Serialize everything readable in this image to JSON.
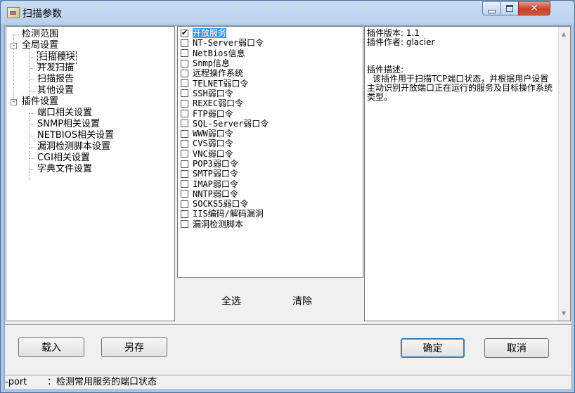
{
  "window": {
    "title": "扫描参数"
  },
  "tree": {
    "items": [
      {
        "label": "检测范围",
        "level": 0,
        "expander": ""
      },
      {
        "label": "全局设置",
        "level": 0,
        "expander": "-"
      },
      {
        "label": "扫描模块",
        "level": 1,
        "expander": ""
      },
      {
        "label": "并发扫描",
        "level": 1,
        "expander": ""
      },
      {
        "label": "扫描报告",
        "level": 1,
        "expander": ""
      },
      {
        "label": "其他设置",
        "level": 1,
        "expander": ""
      },
      {
        "label": "插件设置",
        "level": 0,
        "expander": "-"
      },
      {
        "label": "端口相关设置",
        "level": 1,
        "expander": ""
      },
      {
        "label": "SNMP相关设置",
        "level": 1,
        "expander": ""
      },
      {
        "label": "NETBIOS相关设置",
        "level": 1,
        "expander": ""
      },
      {
        "label": "漏洞检测脚本设置",
        "level": 1,
        "expander": ""
      },
      {
        "label": "CGI相关设置",
        "level": 1,
        "expander": ""
      },
      {
        "label": "字典文件设置",
        "level": 1,
        "expander": ""
      }
    ]
  },
  "modules": {
    "items": [
      {
        "label": "开放服务",
        "checked": true
      },
      {
        "label": "NT-Server弱口令",
        "checked": false
      },
      {
        "label": "NetBios信息",
        "checked": false
      },
      {
        "label": "Snmp信息",
        "checked": false
      },
      {
        "label": "远程操作系统",
        "checked": false
      },
      {
        "label": "TELNET弱口令",
        "checked": false
      },
      {
        "label": "SSH弱口令",
        "checked": false
      },
      {
        "label": "REXEC弱口令",
        "checked": false
      },
      {
        "label": "FTP弱口令",
        "checked": false
      },
      {
        "label": "SQL-Server弱口令",
        "checked": false
      },
      {
        "label": "WWW弱口令",
        "checked": false
      },
      {
        "label": "CVS弱口令",
        "checked": false
      },
      {
        "label": "VNC弱口令",
        "checked": false
      },
      {
        "label": "POP3弱口令",
        "checked": false
      },
      {
        "label": "SMTP弱口令",
        "checked": false
      },
      {
        "label": "IMAP弱口令",
        "checked": false
      },
      {
        "label": "NNTP弱口令",
        "checked": false
      },
      {
        "label": "SOCKS5弱口令",
        "checked": false
      },
      {
        "label": "IIS编码/解码漏洞",
        "checked": false
      },
      {
        "label": "漏洞检测脚本",
        "checked": false
      }
    ],
    "select_all": "全选",
    "clear": "清除"
  },
  "info": {
    "version": "插件版本: 1.1",
    "author": "插件作者: glacier",
    "desc_title": "插件描述:",
    "desc": "该插件用于扫描TCP端口状态，并根据用户设置主动识别开放端口正在运行的服务及目标操作系统类型。"
  },
  "buttons": {
    "load": "载入",
    "save_as": "另存",
    "ok": "确定",
    "cancel": "取消"
  },
  "status": {
    "key": "-port",
    "text": "：检测常用服务的端口状态"
  }
}
